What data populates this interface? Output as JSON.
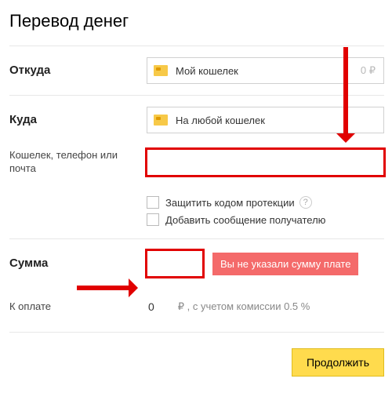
{
  "title": "Перевод денег",
  "from": {
    "label": "Откуда",
    "value": "Мой кошелек",
    "balance": "0 ₽"
  },
  "to": {
    "label": "Куда",
    "value": "На любой кошелек"
  },
  "recipient": {
    "label": "Кошелек, телефон или почта",
    "value": ""
  },
  "options": {
    "protection": "Защитить кодом протекции",
    "message": "Добавить сообщение получателю"
  },
  "sum": {
    "label": "Сумма",
    "value": "",
    "error": "Вы не указали сумму плате"
  },
  "pay": {
    "label": "К оплате",
    "value": "0",
    "note": "₽ , с учетом комиссии 0.5 %"
  },
  "submit": "Продолжить",
  "help_glyph": "?"
}
